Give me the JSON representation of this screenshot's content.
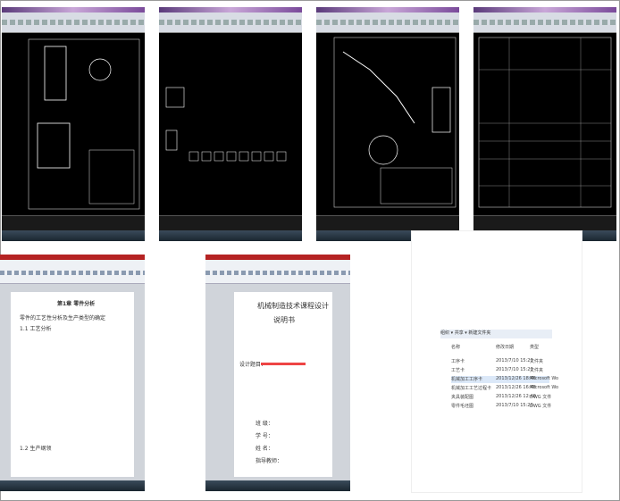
{
  "cad_windows": [
    {
      "id": 1
    },
    {
      "id": 2
    },
    {
      "id": 3
    },
    {
      "id": 4
    }
  ],
  "doc_left": {
    "heading": "第1章 零件分析",
    "lines": [
      "零件的工艺性分析及生产类型的确定",
      "1.1 工艺分析",
      "1.2 生产纲领"
    ]
  },
  "doc_right": {
    "title": "机械制造技术课程设计",
    "subtitle": "说明书",
    "topic_label": "设计题目：",
    "fields": [
      "班 级：",
      "学 号：",
      "姓 名：",
      "指导教师："
    ]
  },
  "explorer": {
    "toolbar": [
      "组织 ▾",
      "共享 ▾",
      "新建文件夹"
    ],
    "columns": [
      "名称",
      "修改日期",
      "类型"
    ],
    "files": [
      {
        "name": "工序卡",
        "date": "2013/7/10 15:23",
        "type": "文件夹"
      },
      {
        "name": "工艺卡",
        "date": "2013/7/10 15:23",
        "type": "文件夹"
      },
      {
        "name": "机械加工工序卡",
        "date": "2013/12/26 18:46",
        "type": "Microsoft Wo"
      },
      {
        "name": "机械加工工艺过程卡",
        "date": "2013/12/26 16:48",
        "type": "Microsoft Wo"
      },
      {
        "name": "夹具装配图",
        "date": "2013/12/26 12:48",
        "type": "DWG 文件"
      },
      {
        "name": "零件毛坯图",
        "date": "2013/7/10 15:23",
        "type": "DWG 文件"
      }
    ]
  }
}
